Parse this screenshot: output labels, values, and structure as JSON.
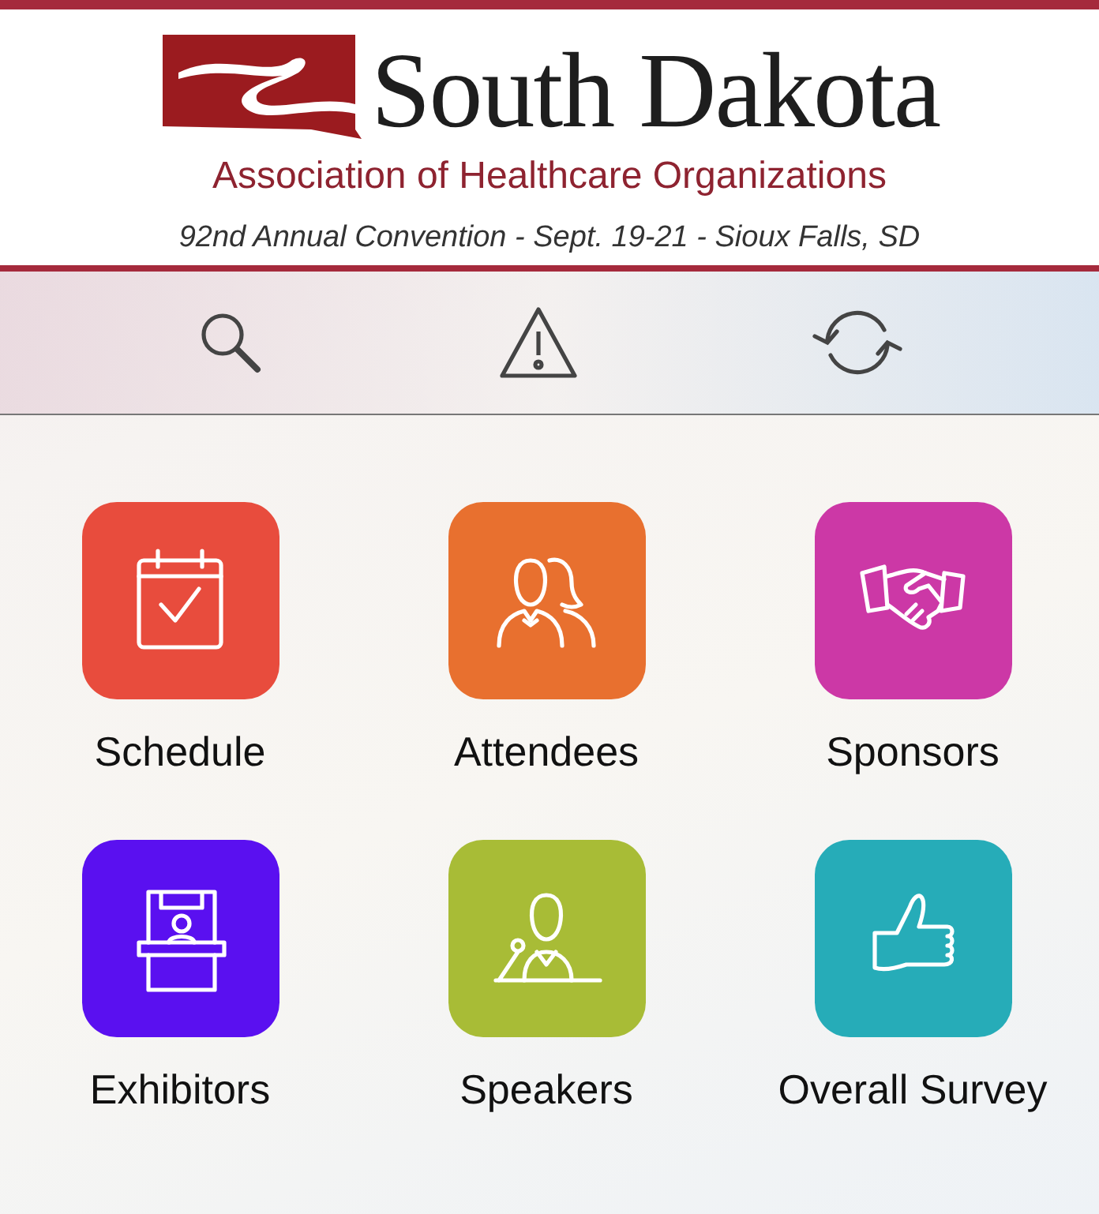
{
  "header": {
    "logo_name": "South Dakota",
    "organization": "Association of Healthcare Organizations",
    "event": "92nd Annual Convention - Sept. 19-21 - Sioux Falls, SD"
  },
  "toolbar": [
    {
      "kind": "search"
    },
    {
      "kind": "alert"
    },
    {
      "kind": "sync"
    }
  ],
  "tiles": [
    {
      "label": "Schedule",
      "kind": "calendar",
      "color": "#e84c3d"
    },
    {
      "label": "Attendees",
      "kind": "people",
      "color": "#e8702f"
    },
    {
      "label": "Sponsors",
      "kind": "handshake",
      "color": "#cc38a6"
    },
    {
      "label": "Exhibitors",
      "kind": "booth",
      "color": "#5a10f0"
    },
    {
      "label": "Speakers",
      "kind": "speaker",
      "color": "#a8bc36"
    },
    {
      "label": "Overall Survey",
      "kind": "thumb",
      "color": "#26acb8"
    }
  ]
}
